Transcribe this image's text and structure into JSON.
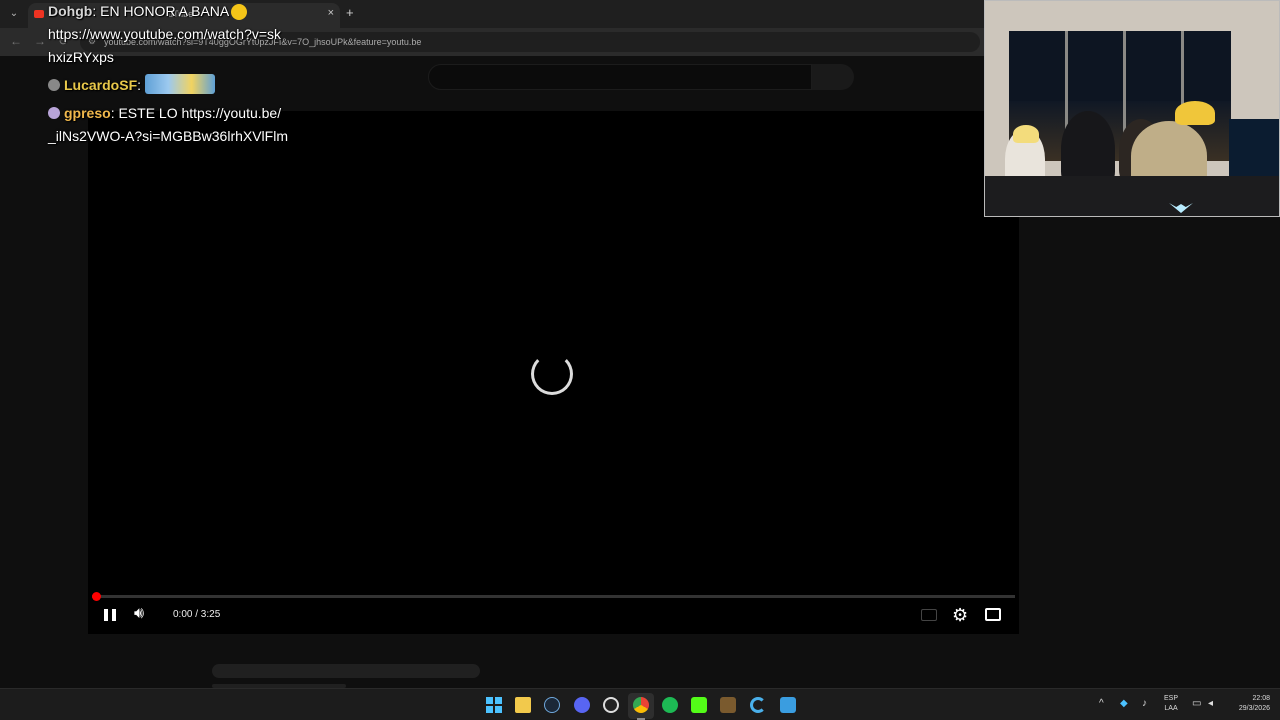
{
  "browser": {
    "tab_title": "uTube",
    "url": "youtube.com/watch?si=9T40ggOGrYt0pzJFI&v=7O_jhsoUPk&feature=youtu.be"
  },
  "chat": [
    {
      "user": "Dohgb",
      "user_color": "#d5d5d5",
      "text": "EN HONOR A BANA",
      "extra": "https://www.youtube.com/watch?v=skhxizRYxps"
    },
    {
      "user": "LucardoSF",
      "user_color": "#e8c84a",
      "text": ""
    },
    {
      "user": "gpreso",
      "user_color": "#f0b84c",
      "text": "ESTE LO https://youtu.be/_ilNs2VWO-A?si=MGBBw36lrhXVlFlm"
    }
  ],
  "player": {
    "time": "0:00 / 3:25",
    "progress": 0.0,
    "state": "loading"
  },
  "taskbar": {
    "lang_top": "ESP",
    "lang_bottom": "LAA",
    "time": "22:08",
    "date": "29/3/2026"
  },
  "colors": {
    "progress_played": "#ff0000",
    "background": "#0f0f0f",
    "accent": "#4cc2ff"
  },
  "icons": [
    "chevron-down-icon",
    "youtube-favicon",
    "close-icon",
    "plus-icon",
    "back-icon",
    "forward-icon",
    "reload-icon",
    "site-info-icon",
    "spinner-icon",
    "pause-icon",
    "volume-icon",
    "subtitles-icon",
    "settings-icon",
    "theater-icon",
    "windows-start-icon",
    "file-explorer-icon",
    "steam-icon",
    "discord-icon",
    "obs-icon",
    "chrome-icon",
    "spotify-icon",
    "kick-icon",
    "minecraft-icon",
    "ccleaner-icon",
    "notepad-icon",
    "tray-chevron-icon",
    "shield-icon",
    "mic-icon",
    "monitor-icon",
    "speaker-icon"
  ]
}
